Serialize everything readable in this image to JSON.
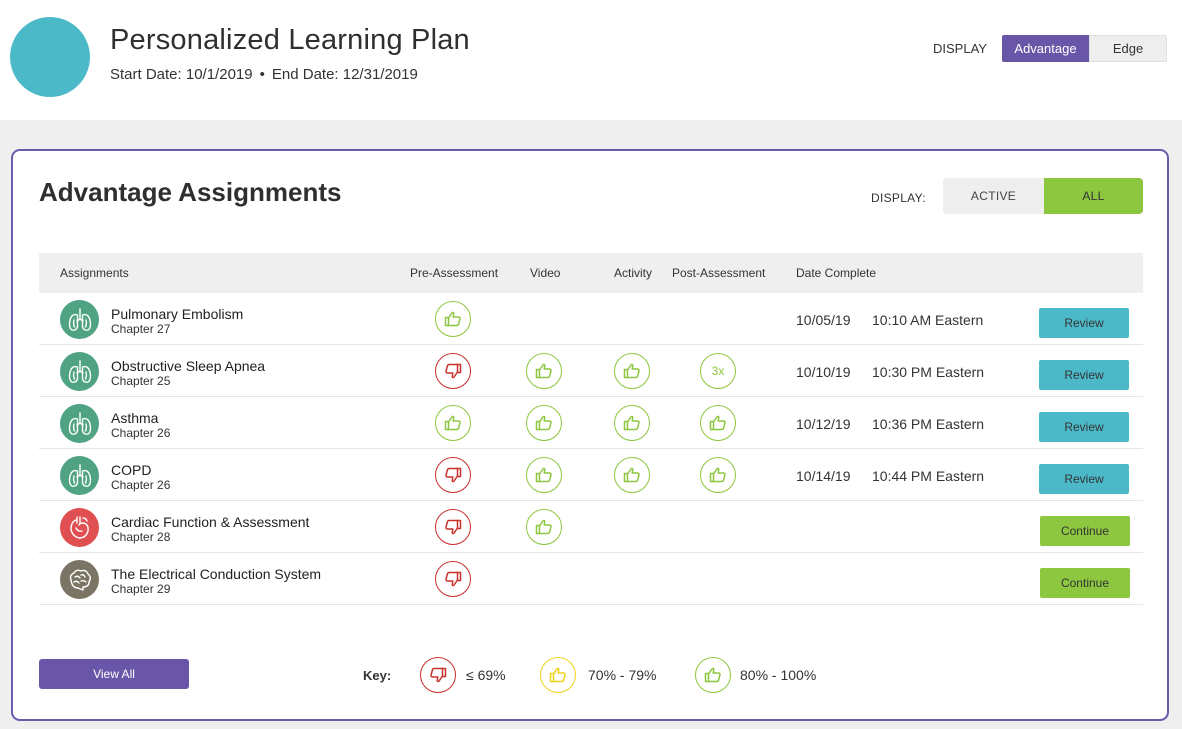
{
  "header": {
    "title": "Personalized Learning Plan",
    "start_date": "Start Date: 10/1/2019",
    "separator": "•",
    "end_date": "End Date: 12/31/2019",
    "display_label": "DISPLAY",
    "display_options": [
      "Advantage",
      "Edge"
    ],
    "display_selected": "Advantage"
  },
  "card": {
    "title": "Advantage Assignments",
    "display_label": "DISPLAY:",
    "filter_options": [
      "ACTIVE",
      "ALL"
    ],
    "filter_selected": "ALL",
    "columns": [
      "Assignments",
      "Pre-Assessment",
      "Video",
      "Activity",
      "Post-Assessment",
      "Date Complete"
    ],
    "rows": [
      {
        "name": "Pulmonary Embolism",
        "chapter": "Chapter 27",
        "icon": "lungs-icon",
        "pre": "good",
        "video": "",
        "activity": "",
        "post": "",
        "date": "10/05/19",
        "time": "10:10 AM Eastern",
        "action": "Review"
      },
      {
        "name": "Obstructive Sleep Apnea",
        "chapter": "Chapter 25",
        "icon": "lungs-icon",
        "pre": "bad",
        "video": "good",
        "activity": "good",
        "post": "3x",
        "date": "10/10/19",
        "time": "10:30 PM Eastern",
        "action": "Review"
      },
      {
        "name": "Asthma",
        "chapter": "Chapter 26",
        "icon": "lungs-icon",
        "pre": "good",
        "video": "good",
        "activity": "good",
        "post": "good",
        "date": "10/12/19",
        "time": "10:36 PM Eastern",
        "action": "Review"
      },
      {
        "name": "COPD",
        "chapter": "Chapter 26",
        "icon": "lungs-icon",
        "pre": "bad",
        "video": "good",
        "activity": "good",
        "post": "good",
        "date": "10/14/19",
        "time": "10:44 PM Eastern",
        "action": "Review"
      },
      {
        "name": "Cardiac Function & Assessment",
        "chapter": "Chapter 28",
        "icon": "heart-icon",
        "pre": "bad",
        "video": "good",
        "activity": "",
        "post": "",
        "date": "",
        "time": "",
        "action": "Continue"
      },
      {
        "name": "The Electrical Conduction System",
        "chapter": "Chapter 29",
        "icon": "brain-icon",
        "pre": "bad",
        "video": "",
        "activity": "",
        "post": "",
        "date": "",
        "time": "",
        "action": "Continue"
      }
    ],
    "view_all": "View All",
    "key": {
      "label": "Key:",
      "items": [
        {
          "status": "bad",
          "text": "≤ 69%"
        },
        {
          "status": "mid",
          "text": "70% - 79%"
        },
        {
          "status": "good",
          "text": "80% - 100%"
        }
      ]
    }
  },
  "colors": {
    "purple": "#6a56a8",
    "teal": "#4cb9c9",
    "green": "#8dc63f",
    "red": "#c8302c",
    "yellow": "#f0d21a",
    "lungs_bg": "#4fa383",
    "heart_bg": "#e04f52",
    "brain_bg": "#7a7464"
  }
}
